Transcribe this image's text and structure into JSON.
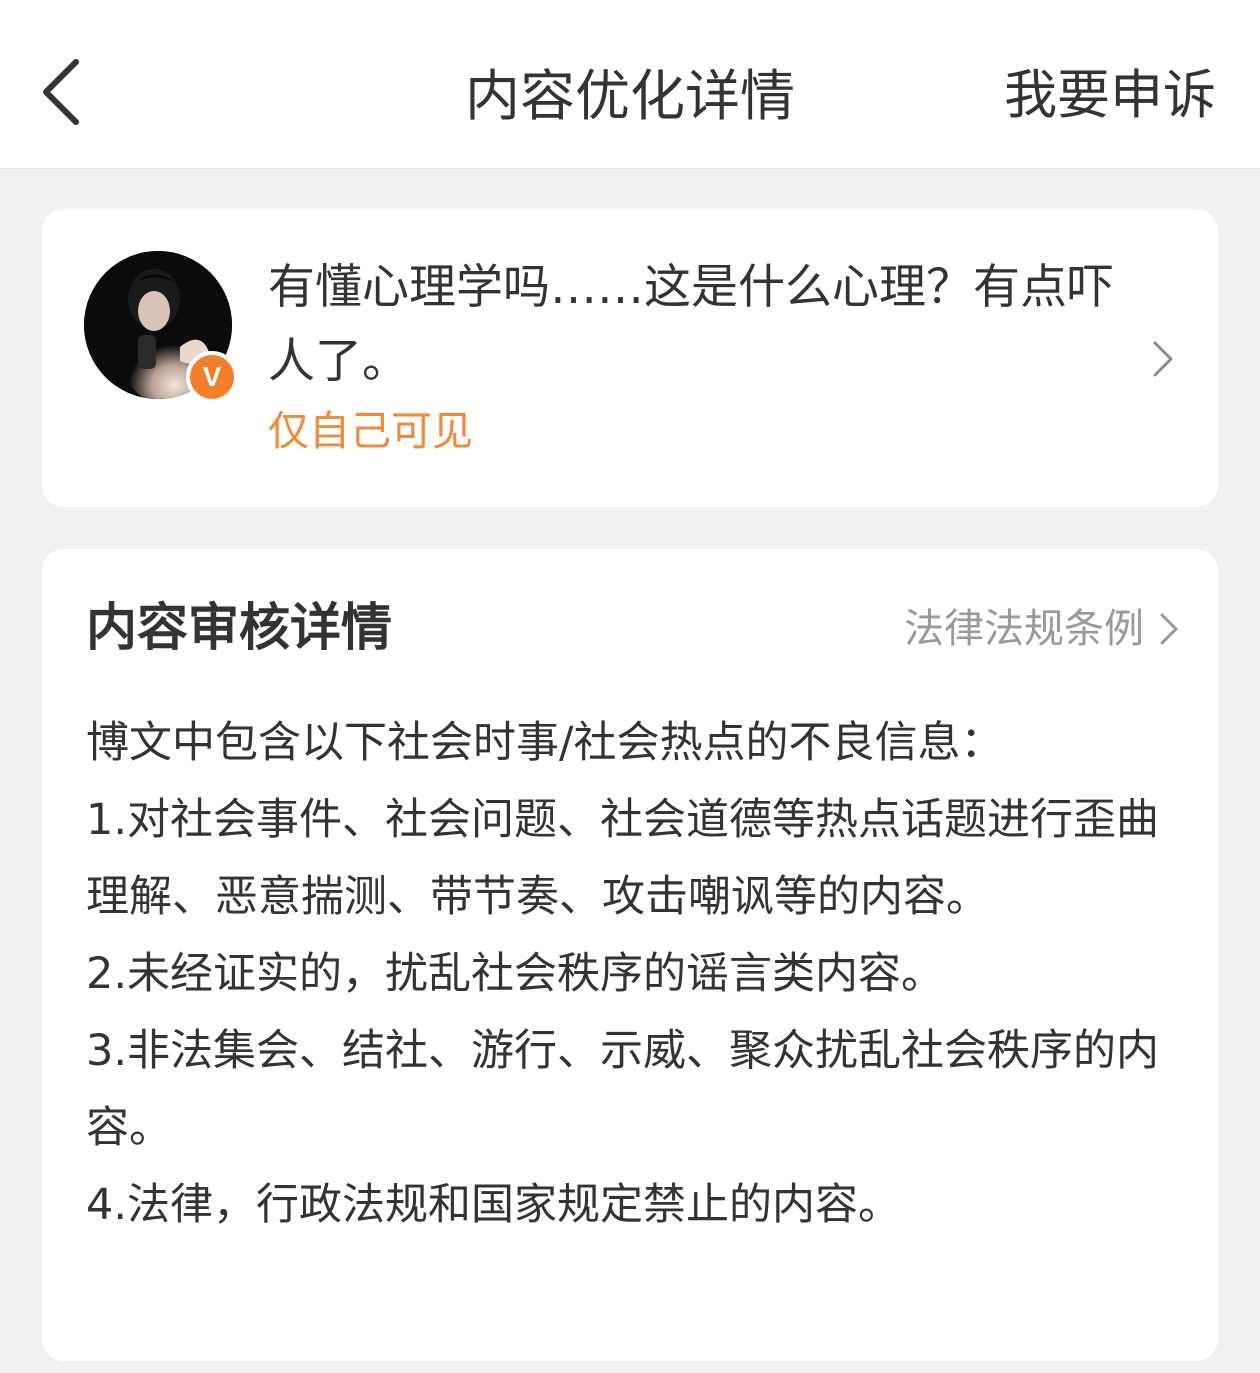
{
  "nav": {
    "title": "内容优化详情",
    "appeal_label": "我要申诉",
    "back_icon": "chevron-left-icon"
  },
  "post": {
    "text": "有懂心理学吗……这是什么心理？有点吓人了。",
    "visibility": "仅自己可见",
    "verified_badge": "V",
    "accent_color": "#f27f2c"
  },
  "review": {
    "title": "内容审核详情",
    "law_link_label": "法律法规条例",
    "lines": [
      "博文中包含以下社会时事/社会热点的不良信息：",
      "1.对社会事件、社会问题、社会道德等热点话题进行歪曲理解、恶意揣测、带节奏、攻击嘲讽等的内容。",
      "2.未经证实的，扰乱社会秩序的谣言类内容。",
      "3.非法集会、结社、游行、示威、聚众扰乱社会秩序的内容。",
      "4.法律，行政法规和国家规定禁止的内容。"
    ]
  }
}
